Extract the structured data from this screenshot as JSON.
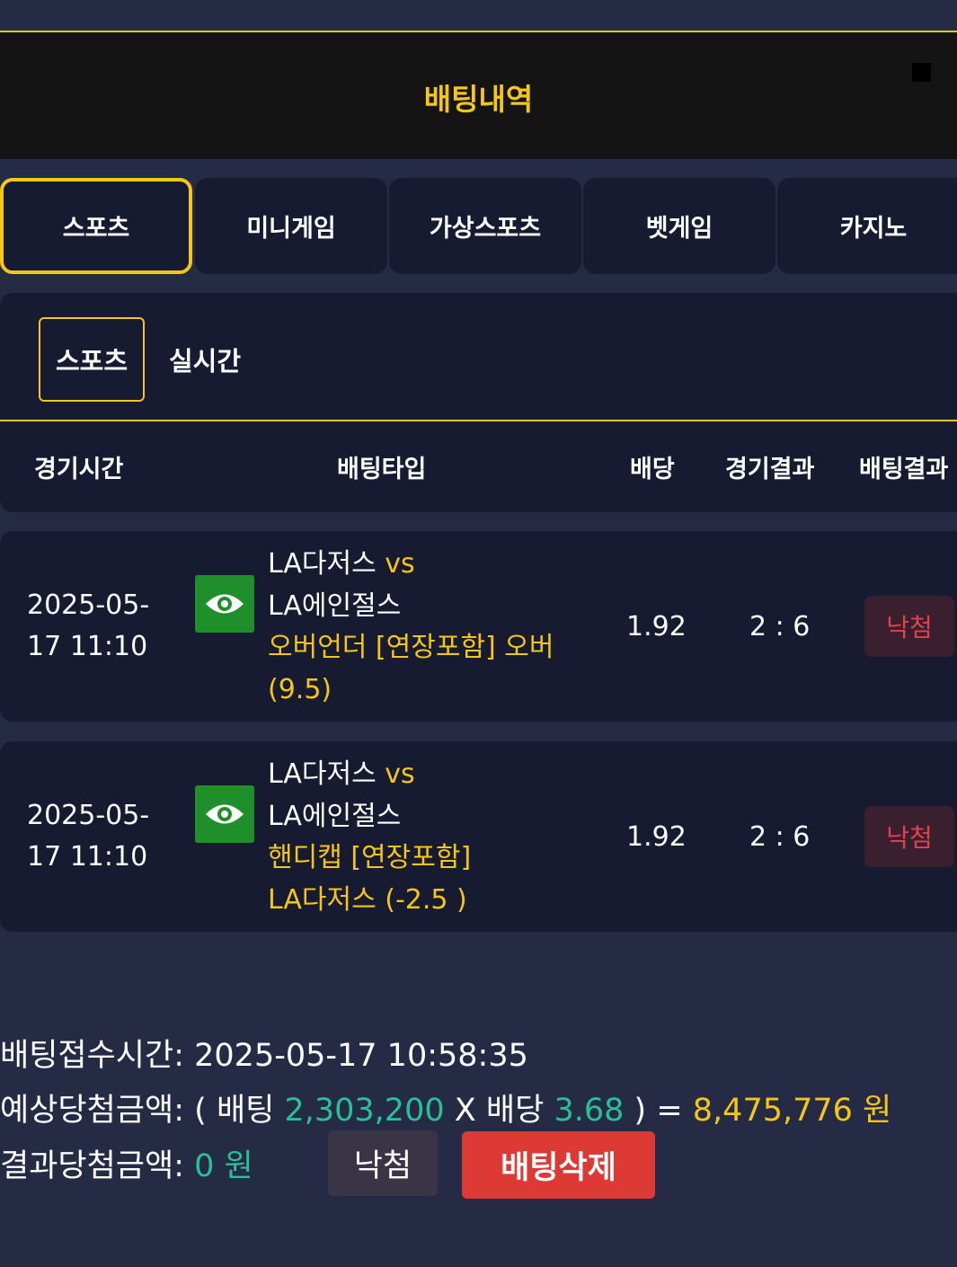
{
  "header": {
    "title": "배팅내역"
  },
  "tabs": [
    {
      "label": "스포츠",
      "active": true
    },
    {
      "label": "미니게임",
      "active": false
    },
    {
      "label": "가상스포츠",
      "active": false
    },
    {
      "label": "벳게임",
      "active": false
    },
    {
      "label": "카지노",
      "active": false
    }
  ],
  "subtabs": [
    {
      "label": "스포츠",
      "active": true
    },
    {
      "label": "실시간",
      "active": false
    }
  ],
  "columns": {
    "time": "경기시간",
    "bet_type": "배팅타입",
    "odds": "배당",
    "game_result": "경기결과",
    "bet_result": "배팅결과"
  },
  "rows": [
    {
      "time_date": "2025-05-",
      "time_clock": "17 11:10",
      "home": "LA다저스",
      "vs": "vs",
      "away": "LA에인절스",
      "market": "오버언더 [연장포함] 오버",
      "pick": "(9.5)",
      "odds": "1.92",
      "score": "2 : 6",
      "result": "낙첨"
    },
    {
      "time_date": "2025-05-",
      "time_clock": "17 11:10",
      "home": "LA다저스",
      "vs": "vs",
      "away": "LA에인절스",
      "market": "핸디캡 [연장포함]",
      "pick": "LA다저스 (-2.5 )",
      "odds": "1.92",
      "score": "2 : 6",
      "result": "낙첨"
    }
  ],
  "summary": {
    "receipt_label": "배팅접수시간:",
    "receipt_time": "2025-05-17 10:58:35",
    "expected_label": "예상당첨금액:",
    "open_paren": "(",
    "bet_label": "배팅",
    "bet_amount": "2,303,200",
    "times": "X",
    "odds_label": "배당",
    "total_odds": "3.68",
    "close_paren": ")",
    "equals": "=",
    "expected_amount": "8,475,776 원",
    "result_label": "결과당첨금액:",
    "result_amount": "0 원",
    "status_button": "낙첨",
    "delete_button": "배팅삭제"
  },
  "colors": {
    "accent": "#f5c518",
    "background": "#262b45",
    "panel": "#161b31",
    "green": "#27c09a",
    "lose_text": "#e0424b",
    "delete_button": "#dd3a35"
  }
}
